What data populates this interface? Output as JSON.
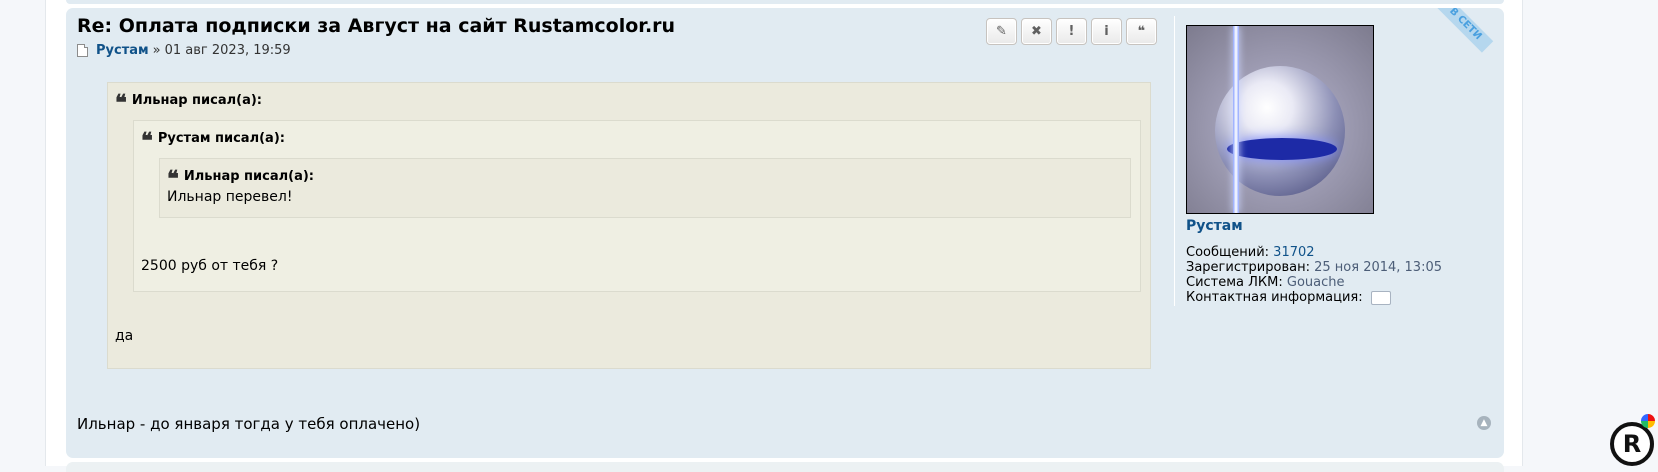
{
  "post": {
    "title": "Re: Оплата подписки за Август на сайт Rustamcolor.ru",
    "author": "Рустам",
    "separator": "»",
    "date": "01 авг 2023, 19:59",
    "buttons": [
      {
        "name": "edit",
        "glyph": "✎"
      },
      {
        "name": "delete",
        "glyph": "✖"
      },
      {
        "name": "report",
        "glyph": "!"
      },
      {
        "name": "info",
        "glyph": "i"
      },
      {
        "name": "quote",
        "glyph": "❝"
      }
    ],
    "quotes": {
      "outer": {
        "cite": "Ильнар писал(а):",
        "text": "да"
      },
      "middle": {
        "cite": "Рустам писал(а):",
        "text": "2500 руб от тебя ?"
      },
      "inner": {
        "cite": "Ильнар писал(а):",
        "text": "Ильнар перевел!"
      }
    },
    "text": "Ильнар - до января тогда у тебя оплачено)"
  },
  "profile": {
    "username": "Рустам",
    "online": "В СЕТИ",
    "posts_label": "Сообщений:",
    "posts_value": "31702",
    "registered_label": "Зарегистрирован:",
    "registered_value": "25 ноя 2014, 13:05",
    "system_label": "Система ЛКМ:",
    "system_value": "Gouache",
    "contact_label": "Контактная информация:"
  },
  "colors": {
    "post_bg": "#e1ebf2",
    "link": "#105289",
    "quote_bg": "#ebeadd"
  },
  "logo": {
    "letter": "R"
  }
}
